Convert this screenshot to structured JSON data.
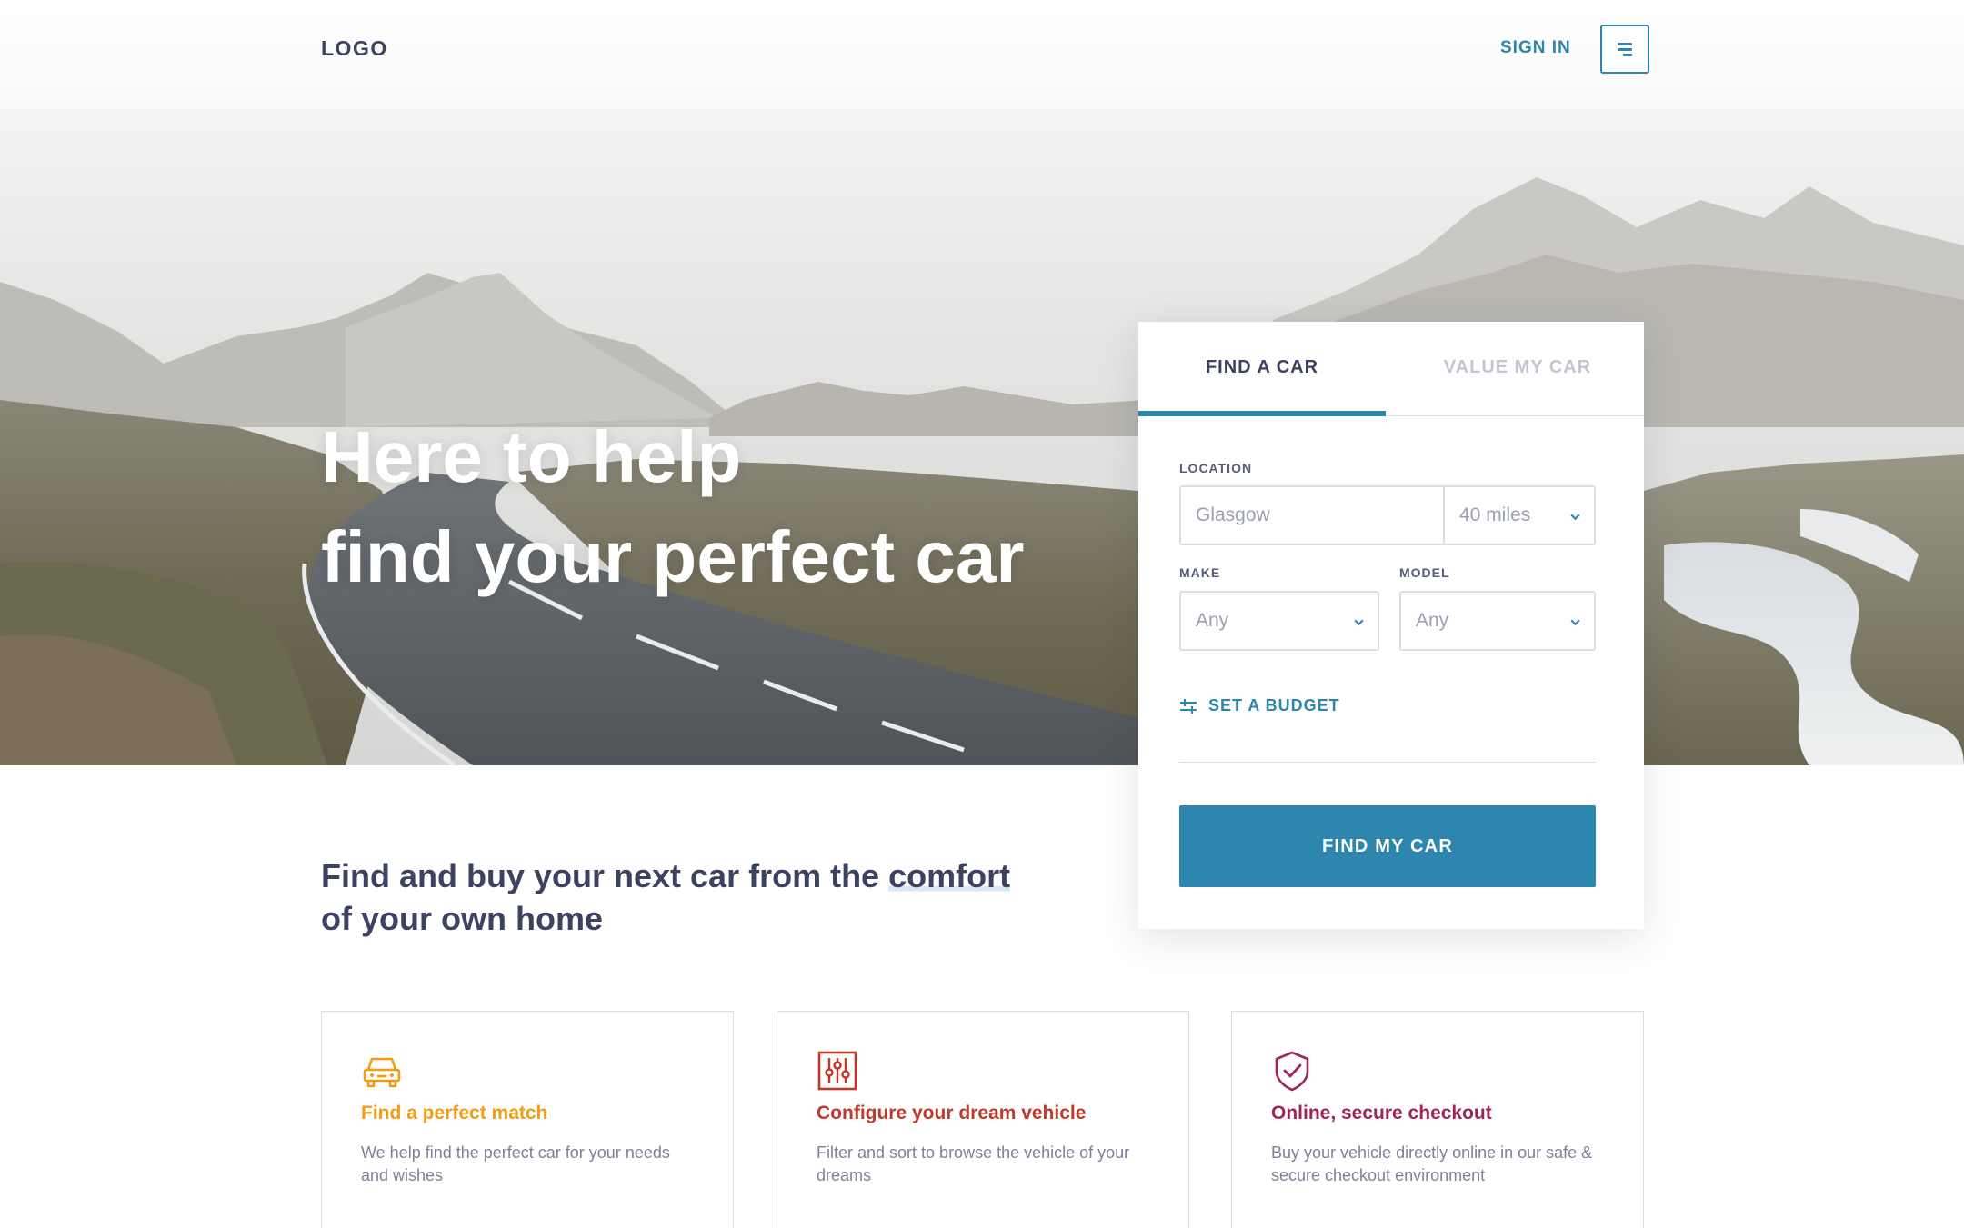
{
  "header": {
    "logo": "LOGO",
    "sign_in": "SIGN IN",
    "menu_icon": "menu-icon"
  },
  "hero": {
    "headline_line1": "Here to help",
    "headline_line2_prefix": "find your ",
    "headline_line2_bold": "perfect",
    "headline_line2_suffix": " car"
  },
  "search": {
    "tabs": [
      {
        "label": "FIND A CAR",
        "active": true
      },
      {
        "label": "VALUE MY CAR",
        "active": false
      }
    ],
    "location": {
      "label": "LOCATION",
      "value": "Glasgow",
      "radius": "40 miles"
    },
    "make": {
      "label": "MAKE",
      "value": "Any"
    },
    "model": {
      "label": "MODEL",
      "value": "Any"
    },
    "budget_label": "SET A BUDGET",
    "submit_label": "FIND MY CAR"
  },
  "tagline": {
    "part1": "Find and buy your next car from the ",
    "highlight": "comfort",
    "part2": "of your own home"
  },
  "features": [
    {
      "icon": "car-icon",
      "title": "Find a perfect match",
      "text": "We help find the perfect car for your needs and wishes",
      "color": "#f39c12"
    },
    {
      "icon": "sliders-icon",
      "title": "Configure your dream vehicle",
      "text": "Filter and sort to browse the vehicle of your  dreams",
      "color": "#c0392b"
    },
    {
      "icon": "shield-check-icon",
      "title": "Online, secure checkout",
      "text": "Buy your vehicle directly online in our safe & secure checkout environment",
      "color": "#a0245c"
    }
  ],
  "colors": {
    "accent": "#2d86ae",
    "text_dark": "#3d4260",
    "muted": "#7d8196"
  }
}
